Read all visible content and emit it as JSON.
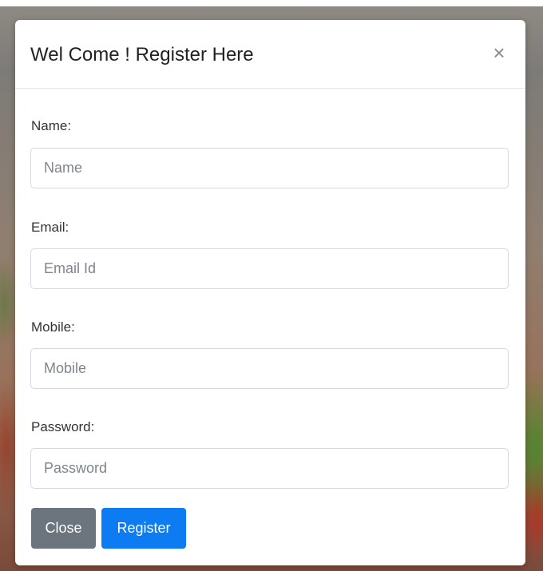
{
  "modal": {
    "title": "Wel Come ! Register Here",
    "close_icon_glyph": "×",
    "close_icon": "close-icon"
  },
  "form": {
    "fields": [
      {
        "label": "Name:",
        "placeholder": "Name",
        "value": ""
      },
      {
        "label": "Email:",
        "placeholder": "Email Id",
        "value": ""
      },
      {
        "label": "Mobile:",
        "placeholder": "Mobile",
        "value": ""
      },
      {
        "label": "Password:",
        "placeholder": "Password",
        "value": ""
      }
    ]
  },
  "buttons": {
    "close_label": "Close",
    "register_label": "Register"
  },
  "colors": {
    "close_button": "#6c757d",
    "register_button": "#0d7bf2"
  }
}
